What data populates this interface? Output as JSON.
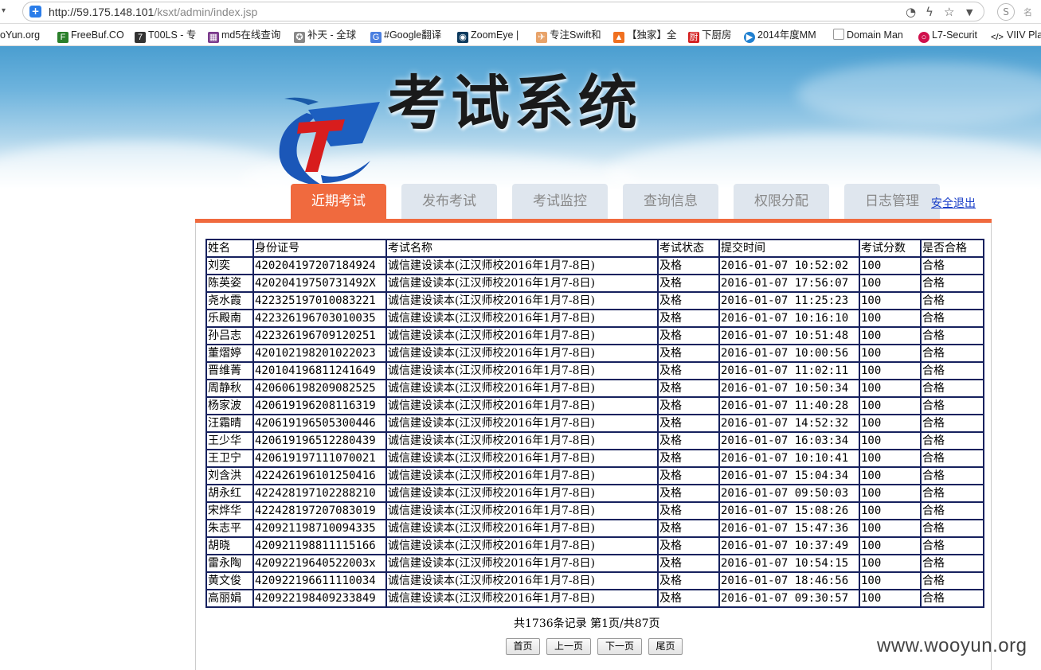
{
  "browser": {
    "url_host": "http://59.175.148.101",
    "url_path": "/ksxt/admin/index.jsp",
    "ext_label": "名"
  },
  "bookmarks": [
    "oYun.org",
    "FreeBuf.CO",
    "T00LS - 专",
    "md5在线查询",
    "补天 - 全球",
    "#Google翻译",
    "ZoomEye |",
    "专注Swift和",
    "【独家】全",
    "下厨房",
    "2014年度MM",
    "Domain Man",
    "L7-Securit",
    "VIIV Pla"
  ],
  "banner": {
    "title": "考试系统"
  },
  "tabs": [
    "近期考试",
    "发布考试",
    "考试监控",
    "查询信息",
    "权限分配",
    "日志管理"
  ],
  "logout_label": "安全退出",
  "table": {
    "headers": [
      "姓名",
      "身份证号",
      "考试名称",
      "考试状态",
      "提交时间",
      "考试分数",
      "是否合格"
    ],
    "rows": [
      [
        "刘奕",
        "420204197207184924",
        "诚信建设读本(江汉师校2016年1月7-8日)",
        "及格",
        "2016-01-07 10:52:02",
        "100",
        "合格"
      ],
      [
        "陈英姿",
        "42020419750731492X",
        "诚信建设读本(江汉师校2016年1月7-8日)",
        "及格",
        "2016-01-07 17:56:07",
        "100",
        "合格"
      ],
      [
        "尧水霞",
        "422325197010083221",
        "诚信建设读本(江汉师校2016年1月7-8日)",
        "及格",
        "2016-01-07 11:25:23",
        "100",
        "合格"
      ],
      [
        "乐殿南",
        "422326196703010035",
        "诚信建设读本(江汉师校2016年1月7-8日)",
        "及格",
        "2016-01-07 10:16:10",
        "100",
        "合格"
      ],
      [
        "孙吕志",
        "422326196709120251",
        "诚信建设读本(江汉师校2016年1月7-8日)",
        "及格",
        "2016-01-07 10:51:48",
        "100",
        "合格"
      ],
      [
        "董熠婷",
        "420102198201022023",
        "诚信建设读本(江汉师校2016年1月7-8日)",
        "及格",
        "2016-01-07 10:00:56",
        "100",
        "合格"
      ],
      [
        "晋维菁",
        "420104196811241649",
        "诚信建设读本(江汉师校2016年1月7-8日)",
        "及格",
        "2016-01-07 11:02:11",
        "100",
        "合格"
      ],
      [
        "周静秋",
        "420606198209082525",
        "诚信建设读本(江汉师校2016年1月7-8日)",
        "及格",
        "2016-01-07 10:50:34",
        "100",
        "合格"
      ],
      [
        "杨家波",
        "420619196208116319",
        "诚信建设读本(江汉师校2016年1月7-8日)",
        "及格",
        "2016-01-07 11:40:28",
        "100",
        "合格"
      ],
      [
        "汪霜晴",
        "420619196505300446",
        "诚信建设读本(江汉师校2016年1月7-8日)",
        "及格",
        "2016-01-07 14:52:32",
        "100",
        "合格"
      ],
      [
        "王少华",
        "420619196512280439",
        "诚信建设读本(江汉师校2016年1月7-8日)",
        "及格",
        "2016-01-07 16:03:34",
        "100",
        "合格"
      ],
      [
        "王卫宁",
        "420619197111070021",
        "诚信建设读本(江汉师校2016年1月7-8日)",
        "及格",
        "2016-01-07 10:10:41",
        "100",
        "合格"
      ],
      [
        "刘含洪",
        "422426196101250416",
        "诚信建设读本(江汉师校2016年1月7-8日)",
        "及格",
        "2016-01-07 15:04:34",
        "100",
        "合格"
      ],
      [
        "胡永红",
        "422428197102288210",
        "诚信建设读本(江汉师校2016年1月7-8日)",
        "及格",
        "2016-01-07 09:50:03",
        "100",
        "合格"
      ],
      [
        "宋烨华",
        "422428197207083019",
        "诚信建设读本(江汉师校2016年1月7-8日)",
        "及格",
        "2016-01-07 15:08:26",
        "100",
        "合格"
      ],
      [
        "朱志平",
        "420921198710094335",
        "诚信建设读本(江汉师校2016年1月7-8日)",
        "及格",
        "2016-01-07 15:47:36",
        "100",
        "合格"
      ],
      [
        "胡晓",
        "420921198811115166",
        "诚信建设读本(江汉师校2016年1月7-8日)",
        "及格",
        "2016-01-07 10:37:49",
        "100",
        "合格"
      ],
      [
        "雷永陶",
        "42092219640522003x",
        "诚信建设读本(江汉师校2016年1月7-8日)",
        "及格",
        "2016-01-07 10:54:15",
        "100",
        "合格"
      ],
      [
        "黄文俊",
        "420922196611110034",
        "诚信建设读本(江汉师校2016年1月7-8日)",
        "及格",
        "2016-01-07 18:46:56",
        "100",
        "合格"
      ],
      [
        "高丽娟",
        "420922198409233849",
        "诚信建设读本(江汉师校2016年1月7-8日)",
        "及格",
        "2016-01-07 09:30:57",
        "100",
        "合格"
      ]
    ]
  },
  "pager": {
    "info": "共1736条记录 第1页/共87页",
    "buttons": [
      "首页",
      "上一页",
      "下一页",
      "尾页"
    ]
  },
  "watermark": "www.wooyun.org",
  "colors": {
    "tab_active": "#f06a3e",
    "tab_inactive": "#dfe6ee",
    "table_border": "#16215e",
    "logout_link": "#1a3fc8"
  }
}
